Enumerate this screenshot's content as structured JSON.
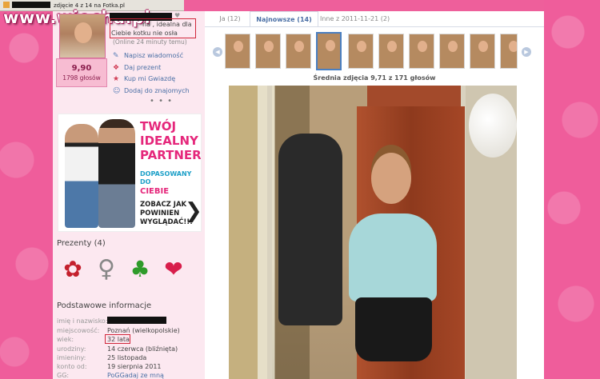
{
  "browser_tab": {
    "title": "zdjęcie 4 z 14 na Fotka.pl"
  },
  "watermark": {
    "text": "www.wiocha.pl"
  },
  "profile": {
    "score": "9,90",
    "votes": "1798 głosów",
    "status_line1": "na , idealna dla",
    "status_line2": "Ciebie kotku nie osła",
    "online": "(Online 24 minuty temu)",
    "actions": [
      {
        "label": "Napisz wiadomość",
        "icon": "pencil-icon"
      },
      {
        "label": "Daj prezent",
        "icon": "gift-icon"
      },
      {
        "label": "Kup mi Gwiazdę",
        "icon": "star-icon"
      },
      {
        "label": "Dodaj do znajomych",
        "icon": "add-friend-icon"
      }
    ],
    "more": "• • •"
  },
  "ad": {
    "lines": [
      "TWÓJ",
      "IDEALNY",
      "PARTNER!",
      "DOPASOWANY",
      "DO",
      "CIEBIE",
      "ZOBACZ JAK",
      "POWINIEN",
      "WYGLĄDAĆ!!!"
    ]
  },
  "gifts": {
    "title": "Prezenty (4)",
    "items": [
      "flowers-icon",
      "figure-icon",
      "clover-icon",
      "lips-icon"
    ]
  },
  "info": {
    "title": "Podstawowe informacje",
    "rows": [
      {
        "label": "imię i nazwisko:",
        "value": ""
      },
      {
        "label": "miejscowość:",
        "value": "Poznań (wielkopolskie)"
      },
      {
        "label": "wiek:",
        "value": "32 lata"
      },
      {
        "label": "urodziny:",
        "value": "14 czerwca (bliźnięta)"
      },
      {
        "label": "imieniny:",
        "value": "25 listopada"
      },
      {
        "label": "konto od:",
        "value": "19 sierpnia 2011"
      },
      {
        "label": "GG:",
        "value": "PoGGadaj ze mną"
      }
    ]
  },
  "photo_tabs": [
    "Ja (12)",
    "Najnowsze (14)",
    "Inne z 2011-11-21 (2)"
  ],
  "thumbnails": {
    "count": 10,
    "active_index": 3
  },
  "photo": {
    "avg_rating": "Średnia zdjęcia 9,71 z 171 głosów"
  },
  "colors": {
    "page_bg": "#ef5d9b",
    "panel_bg": "#fce8f0",
    "link": "#4a6fa5",
    "highlight_border": "#d0263a"
  }
}
